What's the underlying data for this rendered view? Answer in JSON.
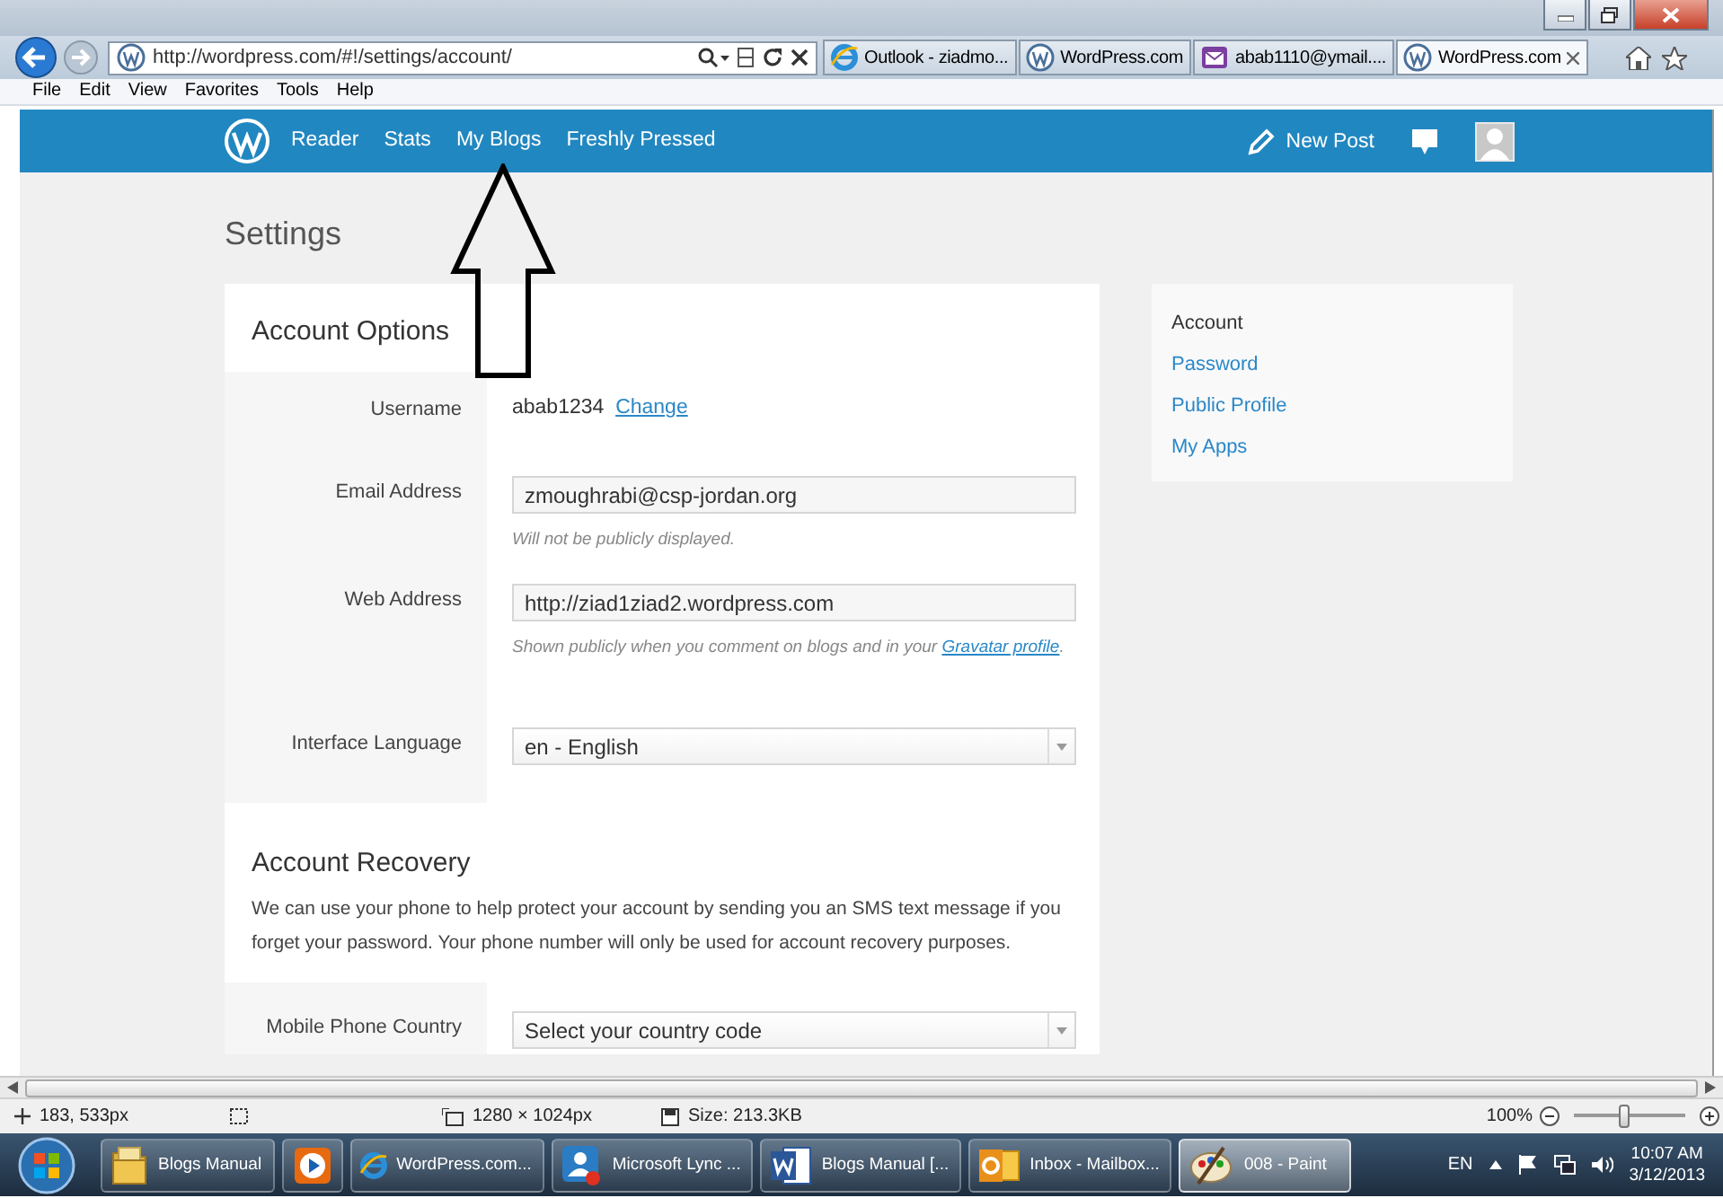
{
  "browser": {
    "address": "http://wordpress.com/#!/settings/account/",
    "tabs": [
      {
        "label": "Outlook - ziadmo...",
        "kind": "ie",
        "selected": false
      },
      {
        "label": "WordPress.com",
        "kind": "wp",
        "selected": false
      },
      {
        "label": "abab1110@ymail....",
        "kind": "mail",
        "selected": false
      },
      {
        "label": "WordPress.com",
        "kind": "wp",
        "selected": true
      }
    ],
    "menu": [
      "File",
      "Edit",
      "View",
      "Favorites",
      "Tools",
      "Help"
    ]
  },
  "wp_nav": {
    "items": [
      "Reader",
      "Stats",
      "My Blogs",
      "Freshly Pressed"
    ],
    "new_post": "New Post"
  },
  "page_title": "Settings",
  "account_options": {
    "heading": "Account Options",
    "fields": [
      {
        "kind": "text",
        "label": "Username",
        "value": "abab1234",
        "link": "Change"
      },
      {
        "kind": "input",
        "label": "Email Address",
        "value": "zmoughrabi@csp-jordan.org",
        "hint": "Will not be publicly displayed."
      },
      {
        "kind": "input",
        "label": "Web Address",
        "value": "http://ziad1ziad2.wordpress.com",
        "hint": "Shown publicly when you comment on blogs and in your",
        "hint_link": "Gravatar profile",
        "hint_end": "."
      },
      {
        "kind": "select",
        "label": "Interface Language",
        "value": "en - English"
      }
    ]
  },
  "account_recovery": {
    "heading": "Account Recovery",
    "text": "We can use your phone to help protect your account by sending you an SMS text message if you forget your password. Your phone number will only be used for account recovery purposes.",
    "fields": [
      {
        "kind": "select",
        "label": "Mobile Phone Country",
        "value": "Select your country code"
      }
    ]
  },
  "sidebar": {
    "items": [
      {
        "label": "Account",
        "selected": true
      },
      {
        "label": "Password",
        "selected": false
      },
      {
        "label": "Public Profile",
        "selected": false
      },
      {
        "label": "My Apps",
        "selected": false
      }
    ]
  },
  "paint_status": {
    "cursor": "183, 533px",
    "dimensions": "1280 × 1024px",
    "size": "Size: 213.3KB",
    "zoom": "100%",
    "zoom_slider": {
      "level": 0.45
    }
  },
  "taskbar": {
    "items": [
      {
        "kind": "folder",
        "label": "Blogs Manual",
        "selected": false
      },
      {
        "kind": "media",
        "selected": false
      },
      {
        "kind": "ie",
        "label": "WordPress.com...",
        "selected": false
      },
      {
        "kind": "lync",
        "label": "Microsoft Lync ...",
        "selected": false
      },
      {
        "kind": "word",
        "label": "Blogs Manual [...",
        "selected": false
      },
      {
        "kind": "outlook",
        "label": "Inbox - Mailbox...",
        "selected": false
      },
      {
        "kind": "paint",
        "label": "008 - Paint",
        "selected": true
      }
    ],
    "language": "EN",
    "time": "10:07 AM",
    "date": "3/12/2013"
  }
}
